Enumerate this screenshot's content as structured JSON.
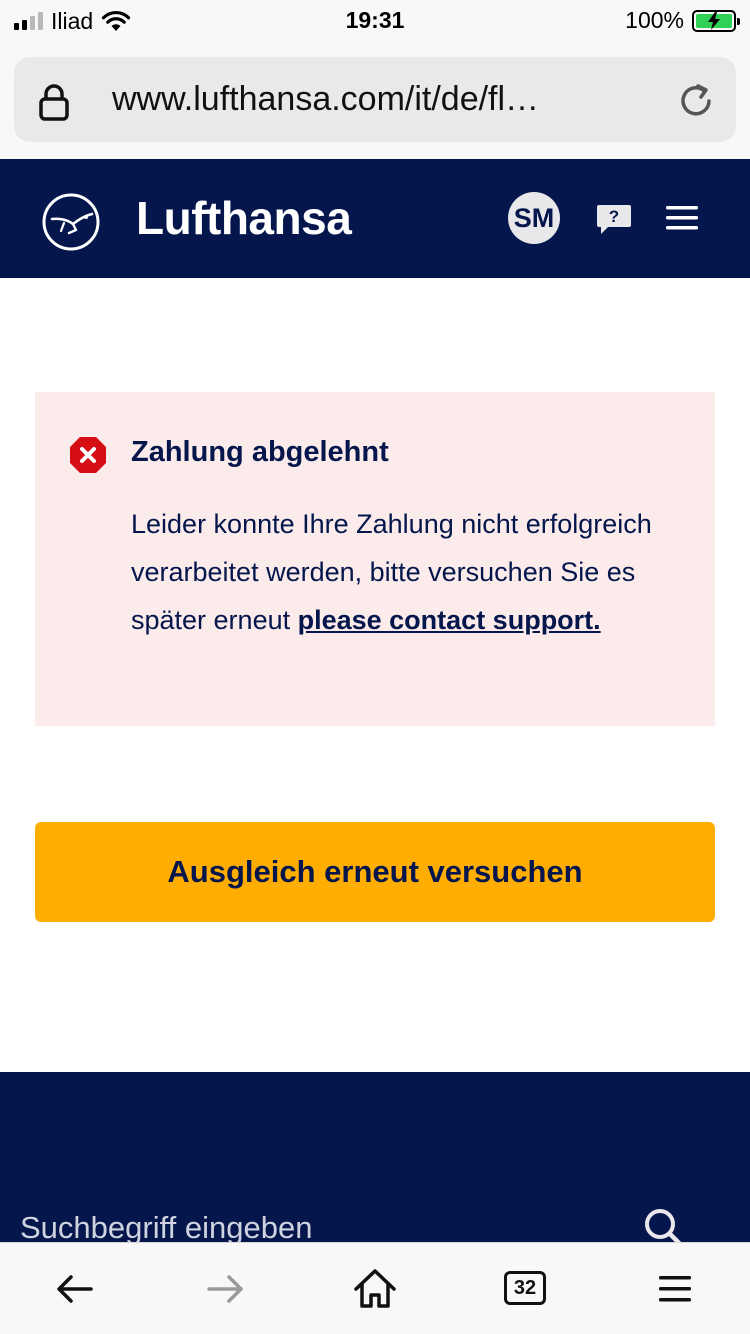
{
  "status_bar": {
    "carrier": "Iliad",
    "time": "19:31",
    "battery": "100%",
    "signal_bars_active": 2,
    "signal_bars_total": 4
  },
  "browser": {
    "url": "www.lufthansa.com/it/de/fl…",
    "tab_count": "32"
  },
  "header": {
    "brand": "Lufthansa",
    "avatar_initials": "SM",
    "icons": [
      "crane-logo-icon",
      "help-chat-icon",
      "hamburger-menu-icon"
    ]
  },
  "error": {
    "title": "Zahlung abgelehnt",
    "message": "Leider konnte Ihre Zahlung nicht erfolgreich verarbeitet werden, bitte versuchen Sie es später erneut ",
    "link": "please contact support."
  },
  "retry_button": {
    "label": "Ausgleich erneut versuchen"
  },
  "footer": {
    "search_placeholder": "Suchbegriff eingeben"
  },
  "colors": {
    "brand_navy": "#05164d",
    "accent_yellow": "#ffad00",
    "error_bg": "#fbeceb",
    "error_red": "#d40e14"
  }
}
